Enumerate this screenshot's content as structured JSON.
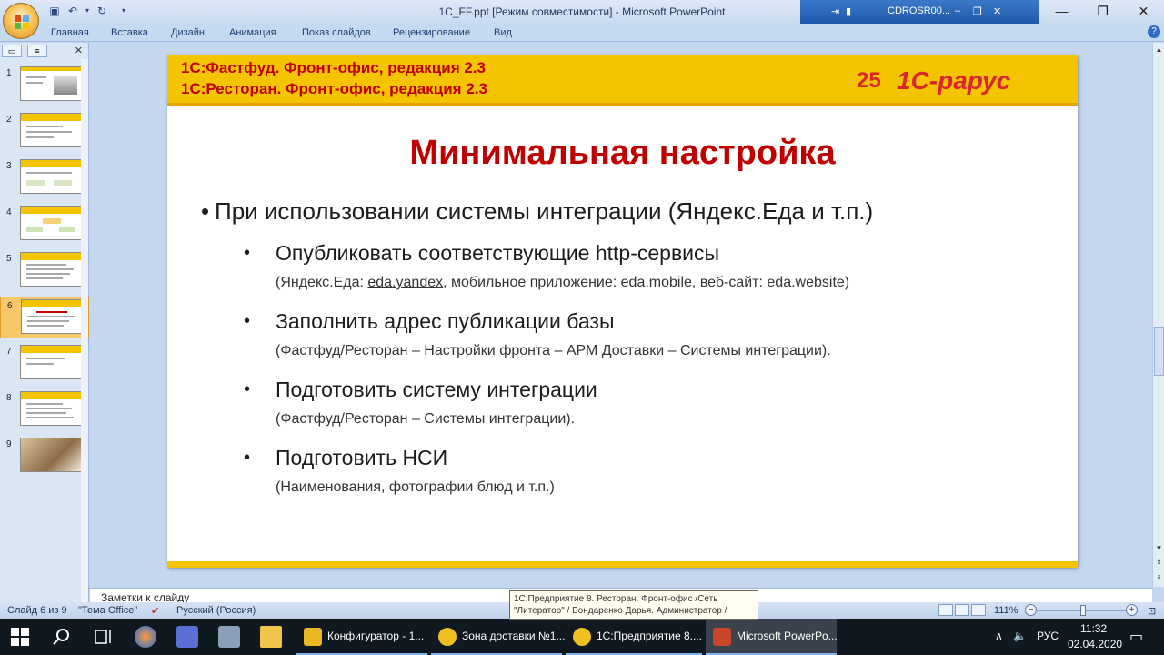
{
  "window": {
    "title": "1C_FF.ppt [Режим совместимости] - Microsoft PowerPoint",
    "remote_label": "CDROSR00..."
  },
  "ribbon": {
    "tabs": [
      "Главная",
      "Вставка",
      "Дизайн",
      "Анимация",
      "Показ слайдов",
      "Рецензирование",
      "Вид"
    ]
  },
  "thumbnails": {
    "numbers": [
      "1",
      "2",
      "3",
      "4",
      "5",
      "6",
      "7",
      "8",
      "9"
    ],
    "selected": "6"
  },
  "slide": {
    "header_line1": "1С:Фастфуд. Фронт-офис, редакция 2.3",
    "header_line2": "1С:Ресторан. Фронт-офис, редакция 2.3",
    "brand_25": "25",
    "brand_word": "1С-рарус",
    "title": "Минимальная настройка",
    "bullet1": "При использовании системы интеграции (Яндекс.Еда и т.п.)",
    "items": [
      {
        "main": "Опубликовать соответствующие http-сервисы",
        "sub_pre": "(Яндекс.Еда: ",
        "sub_link": "eda.yandex",
        "sub_post": ", мобильное приложение: eda.mobile, веб-сайт: eda.website)"
      },
      {
        "main": "Заполнить адрес публикации базы",
        "sub": "(Фастфуд/Ресторан – Настройки фронта – АРМ Доставки – Системы интеграции)."
      },
      {
        "main": "Подготовить систему интеграции",
        "sub": "(Фастфуд/Ресторан – Системы интеграции)."
      },
      {
        "main": "Подготовить НСИ",
        "sub": "(Наименования, фотографии блюд и т.п.)"
      }
    ]
  },
  "notes": {
    "placeholder": "Заметки к слайду"
  },
  "status": {
    "slide_counter": "Слайд 6 из 9",
    "theme": "\"Тема Office\"",
    "language": "Русский (Россия)",
    "zoom": "111%",
    "tooltip_line1": "1С:Предприятие 8. Ресторан. Фронт-офис /Сеть",
    "tooltip_line2": "\"Литератор\" / Бондаренко Дарья. Администратор /"
  },
  "taskbar": {
    "apps": [
      {
        "label": "Конфигуратор - 1...",
        "color": "#e8b923"
      },
      {
        "label": "Зона доставки №1...",
        "color": "#f0c020"
      },
      {
        "label": "1С:Предприятие 8....",
        "color": "#f0c020"
      },
      {
        "label": "Microsoft PowerPo...",
        "color": "#c9462b"
      }
    ],
    "lang": "РУС",
    "time": "11:32",
    "date": "02.04.2020"
  },
  "colors": {
    "accent_red": "#c00000",
    "band_yellow": "#f5c400"
  }
}
